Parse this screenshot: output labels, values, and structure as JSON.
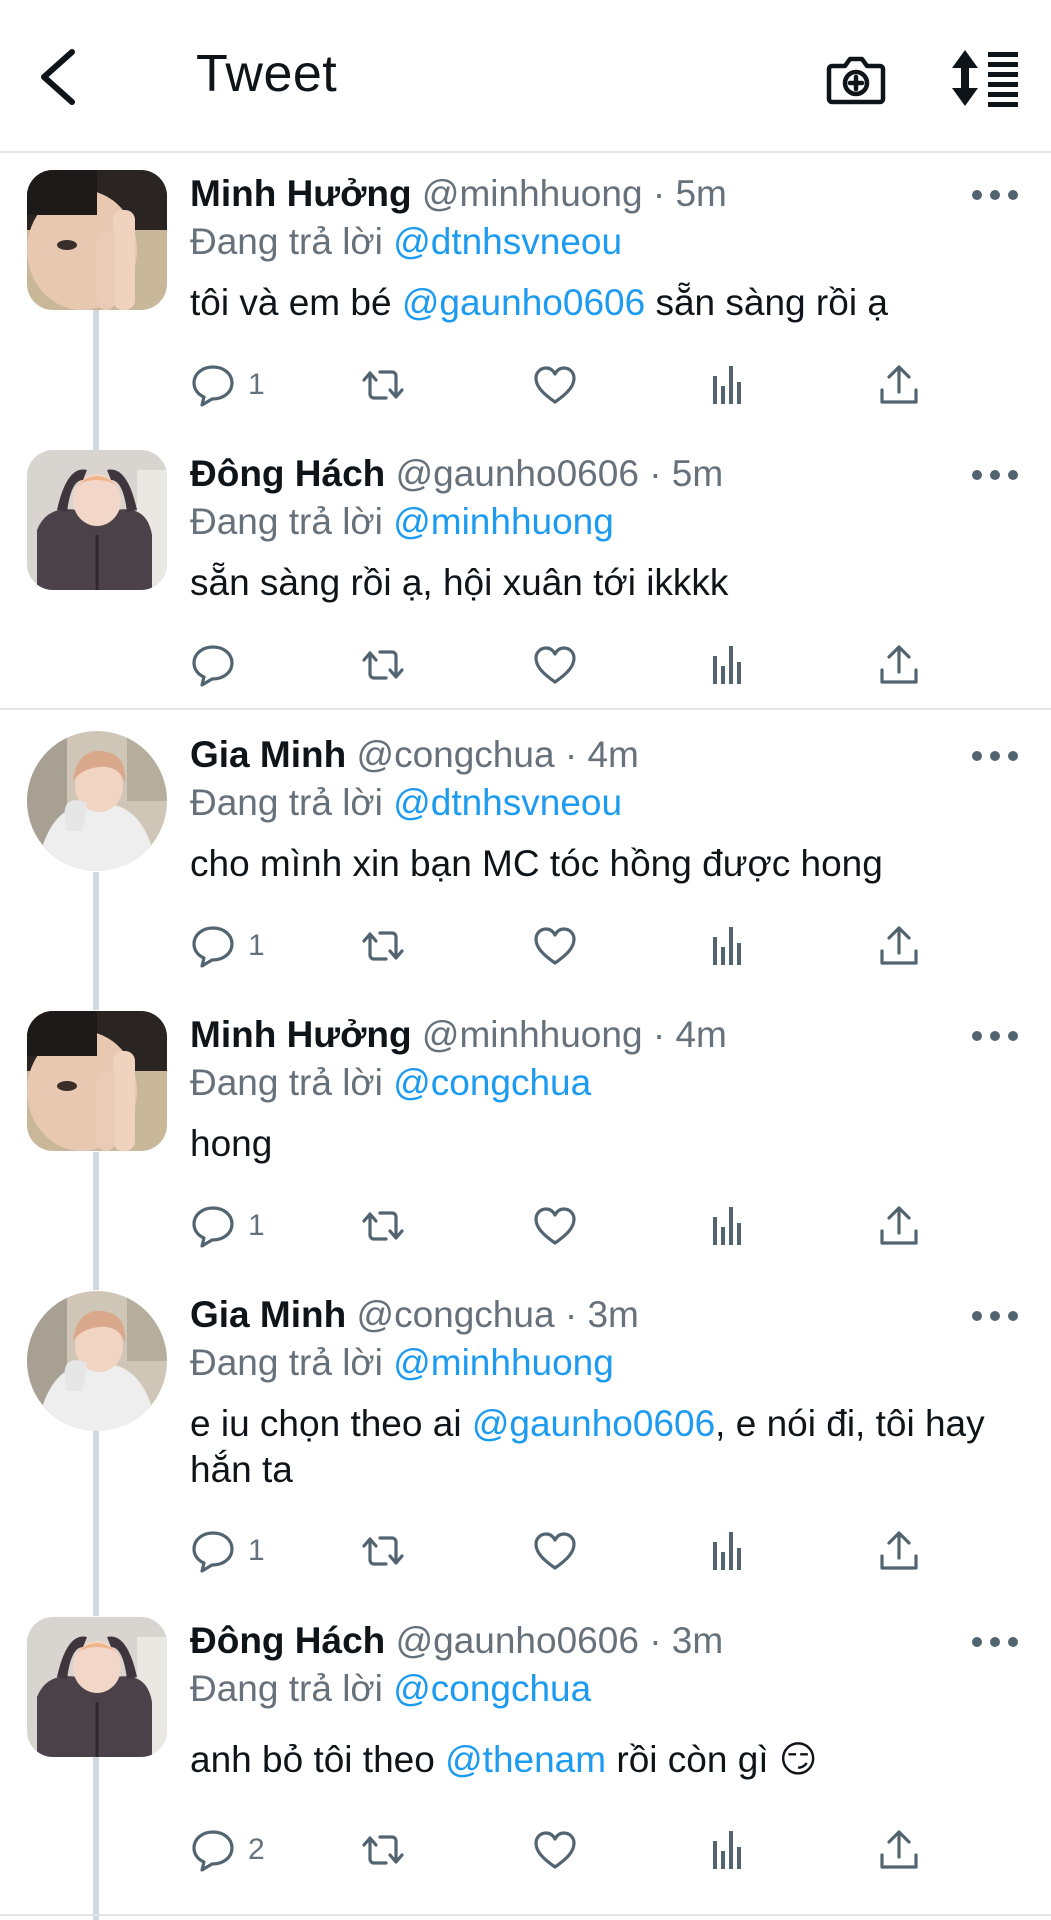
{
  "header": {
    "title": "Tweet"
  },
  "tweets": [
    {
      "name": "Minh Hưởng",
      "handle": "@minhhuong",
      "dot": "·",
      "time": "5m",
      "reply_label": "Đang trả lời",
      "reply_to": "@dtnhsvneou",
      "text_parts": [
        "tôi và em bé ",
        "@gaunho0606",
        " sẵn sàng rồi ạ"
      ],
      "replies": "1"
    },
    {
      "name": "Đông Hách",
      "handle": "@gaunho0606",
      "dot": "·",
      "time": "5m",
      "reply_label": "Đang trả lời",
      "reply_to": "@minhhuong",
      "text": "sẵn sàng rồi ạ, hội xuân tới ikkkk",
      "replies": ""
    },
    {
      "name": "Gia Minh",
      "handle": "@congchua",
      "dot": "·",
      "time": "4m",
      "reply_label": "Đang trả lời",
      "reply_to": "@dtnhsvneou",
      "text": "cho mình xin bạn MC tóc hồng được hong",
      "replies": "1"
    },
    {
      "name": "Minh Hưởng",
      "handle": "@minhhuong",
      "dot": "·",
      "time": "4m",
      "reply_label": "Đang trả lời",
      "reply_to": "@congchua",
      "text": "hong",
      "replies": "1"
    },
    {
      "name": "Gia Minh",
      "handle": "@congchua",
      "dot": "·",
      "time": "3m",
      "reply_label": "Đang trả lời",
      "reply_to": "@minhhuong",
      "text_parts": [
        "e iu chọn theo ai ",
        "@gaunho0606",
        ", e nói đi, tôi hay hắn ta"
      ],
      "replies": "1"
    },
    {
      "name": "Đông Hách",
      "handle": "@gaunho0606",
      "dot": "·",
      "time": "3m",
      "reply_label": "Đang trả lời",
      "reply_to": "@congchua",
      "text_parts": [
        "anh bỏ tôi theo ",
        "@thenam",
        " rồi còn gì ",
        "😏"
      ],
      "replies": "2"
    }
  ],
  "icons": {
    "back": "chevron-left-icon",
    "camera": "camera-plus-icon",
    "sort": "sort-lines-icon",
    "reply": "comment-bubble-icon",
    "retweet": "retweet-icon",
    "like": "heart-icon",
    "views": "bar-chart-icon",
    "share": "share-upload-icon",
    "more": "more-dots-icon"
  },
  "colors": {
    "accent": "#1d9bf0",
    "secondary_text": "#66717b",
    "icon": "#536471",
    "thread_line": "#cfd9de"
  }
}
